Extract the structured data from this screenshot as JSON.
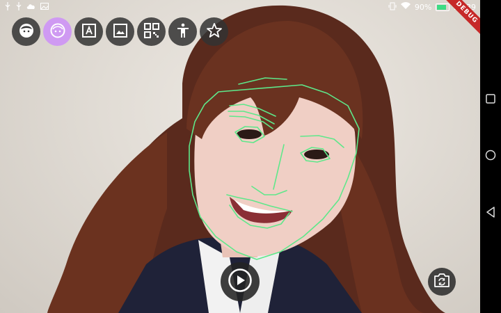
{
  "status_bar": {
    "left_icons": [
      "usb-icon",
      "usb-icon",
      "cloud-icon",
      "image-icon"
    ],
    "right_icons": [
      "vibrate-icon",
      "wifi-icon",
      "battery-icon"
    ],
    "battery": "90%",
    "time": "23:39"
  },
  "debug_banner": "DEBUG",
  "toolbar": {
    "buttons": [
      {
        "icon": "face-icon",
        "active": false
      },
      {
        "icon": "face-contour-icon",
        "active": true
      },
      {
        "icon": "text-recognition-icon",
        "active": false
      },
      {
        "icon": "image-label-icon",
        "active": false
      },
      {
        "icon": "qr-code-icon",
        "active": false
      },
      {
        "icon": "pose-icon",
        "active": false
      },
      {
        "icon": "star-icon",
        "active": false
      }
    ]
  },
  "controls": {
    "play_icon": "play-icon",
    "camera_switch_icon": "camera-switch-icon"
  },
  "navigation_bar": [
    "recents-icon",
    "home-icon",
    "back-icon"
  ],
  "colors": {
    "contour": "#5ee88a",
    "active_button": "#cf9af2",
    "button_bg": "#323232"
  }
}
